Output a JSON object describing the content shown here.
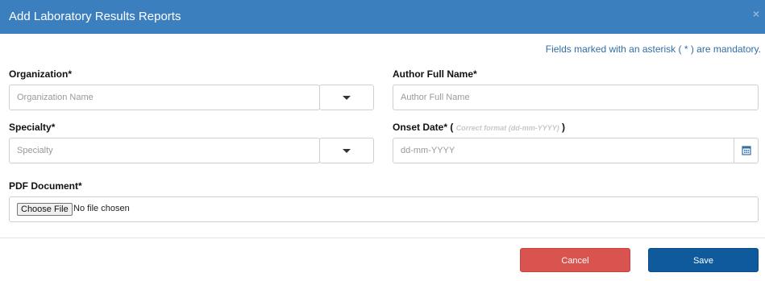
{
  "header": {
    "title": "Add Laboratory Results Reports",
    "close_glyph": "×"
  },
  "mandatory_note": "Fields marked with an asterisk ( * ) are mandatory.",
  "form": {
    "organization": {
      "label": "Organization*",
      "placeholder": "Organization Name",
      "value": ""
    },
    "author": {
      "label": "Author Full Name*",
      "placeholder": "Author Full Name",
      "value": ""
    },
    "specialty": {
      "label": "Specialty*",
      "placeholder": "Specialty",
      "value": ""
    },
    "onset_date": {
      "label": "Onset Date*",
      "hint_open": " ( ",
      "hint": "Correct format (dd-mm-YYYY)",
      "hint_close": " )",
      "placeholder": "dd-mm-YYYY",
      "value": ""
    },
    "pdf_document": {
      "label": "PDF Document*",
      "choose_label": "Choose File",
      "status": "No file chosen"
    }
  },
  "footer": {
    "cancel_label": "Cancel",
    "save_label": "Save"
  },
  "icons": {
    "dropdown": "chevron-down-icon",
    "calendar": "calendar-icon",
    "close": "close-icon"
  },
  "colors": {
    "header_bg": "#3c7fbf",
    "note_text": "#2f6ea7",
    "cancel_bg": "#d9534f",
    "save_bg": "#0e5a9c"
  }
}
